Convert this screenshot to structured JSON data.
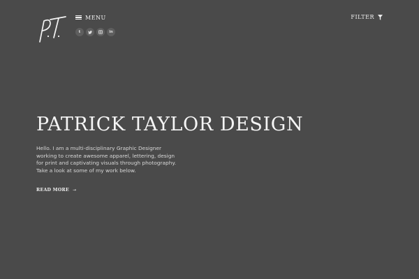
{
  "logo": {
    "text": "P.T."
  },
  "header": {
    "menu_label": "MENU",
    "filter_label": "FILTER",
    "social": [
      {
        "name": "tumblr",
        "glyph": "t"
      },
      {
        "name": "twitter",
        "glyph": "♥"
      },
      {
        "name": "instagram",
        "glyph": "◙"
      },
      {
        "name": "linkedin",
        "glyph": "in"
      }
    ]
  },
  "hero": {
    "title": "PATRICK TAYLOR DESIGN",
    "description": "Hello. I am a multi-disciplinary Graphic Designer working to create awesome apparel, lettering, design for print and captivating visuals through photography. Take a look at some of my work below.",
    "read_more_label": "READ MORE",
    "read_more_arrow": "→"
  },
  "colors": {
    "background": "#4a4a4a",
    "foreground": "#f2f2f2",
    "social_bg": "#5e5e5e"
  }
}
